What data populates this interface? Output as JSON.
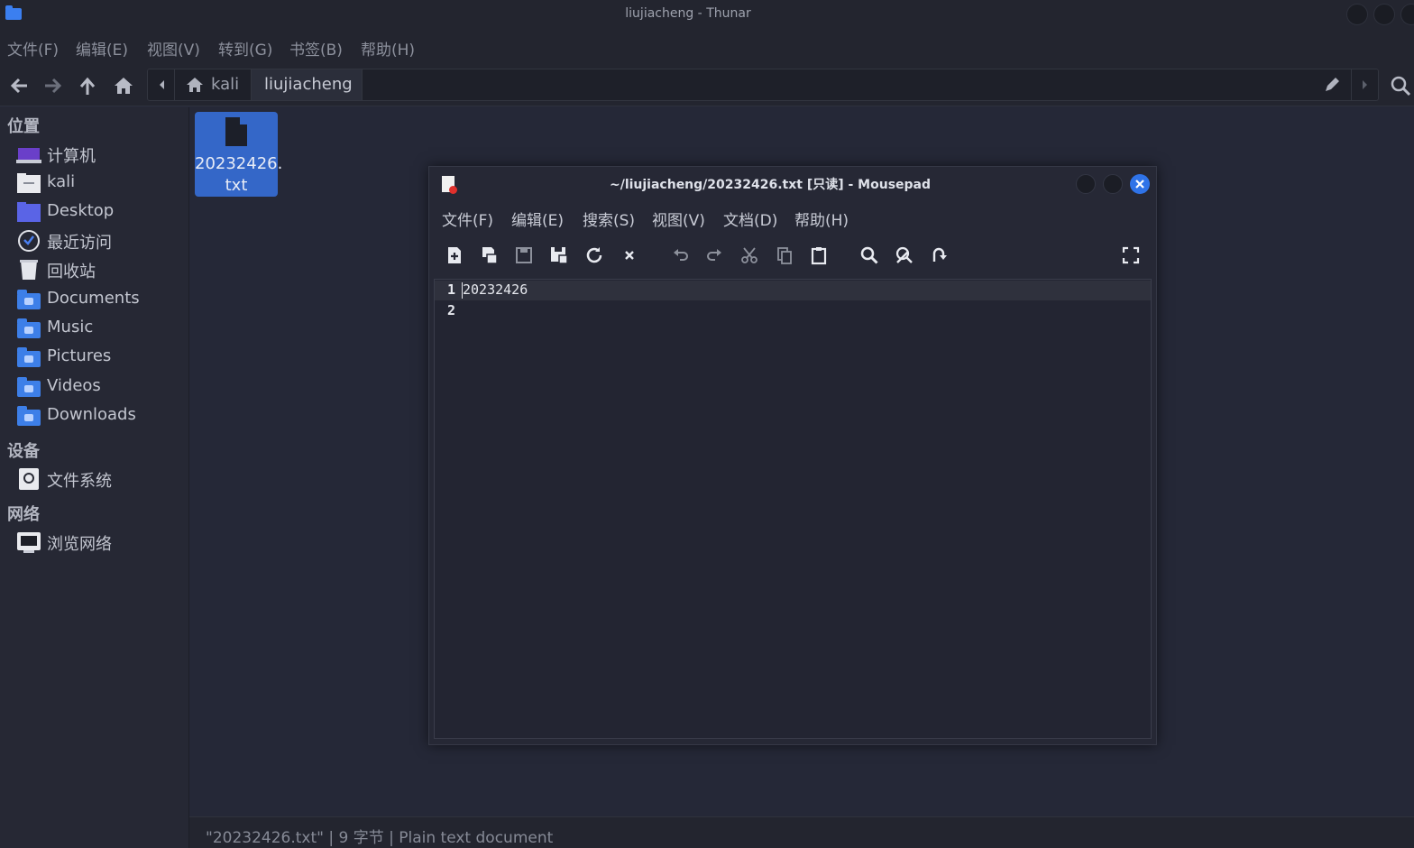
{
  "thunar": {
    "title": "liujiacheng - Thunar",
    "menu": [
      "文件(F)",
      "编辑(E)",
      "视图(V)",
      "转到(G)",
      "书签(B)",
      "帮助(H)"
    ],
    "path": {
      "home": "kali",
      "current": "liujiacheng"
    },
    "sidebar": {
      "places_header": "位置",
      "places": [
        {
          "label": "计算机",
          "icon": "computer-icon"
        },
        {
          "label": "kali",
          "icon": "home-folder-icon"
        },
        {
          "label": "Desktop",
          "icon": "desktop-icon"
        },
        {
          "label": "最近访问",
          "icon": "recent-icon"
        },
        {
          "label": "回收站",
          "icon": "trash-icon"
        },
        {
          "label": "Documents",
          "icon": "documents-folder-icon"
        },
        {
          "label": "Music",
          "icon": "music-folder-icon"
        },
        {
          "label": "Pictures",
          "icon": "pictures-folder-icon"
        },
        {
          "label": "Videos",
          "icon": "videos-folder-icon"
        },
        {
          "label": "Downloads",
          "icon": "downloads-folder-icon"
        }
      ],
      "devices_header": "设备",
      "devices": [
        {
          "label": "文件系统",
          "icon": "drive-icon"
        }
      ],
      "network_header": "网络",
      "network": [
        {
          "label": "浏览网络",
          "icon": "network-icon"
        }
      ]
    },
    "files": [
      {
        "name_line1": "20232426.",
        "name_line2": "txt",
        "selected": true
      }
    ],
    "status": "\"20232426.txt\"  |  9 字节  |  Plain text document"
  },
  "mousepad": {
    "title": "~/liujiacheng/20232426.txt [只读] - Mousepad",
    "menu": [
      "文件(F)",
      "编辑(E)",
      "搜索(S)",
      "视图(V)",
      "文档(D)",
      "帮助(H)"
    ],
    "lines": [
      {
        "number": "1",
        "text": "20232426"
      },
      {
        "number": "2",
        "text": ""
      }
    ]
  },
  "colors": {
    "accent": "#3b7ff0",
    "window_bg": "#252837",
    "close_button": "#2f73e8"
  }
}
